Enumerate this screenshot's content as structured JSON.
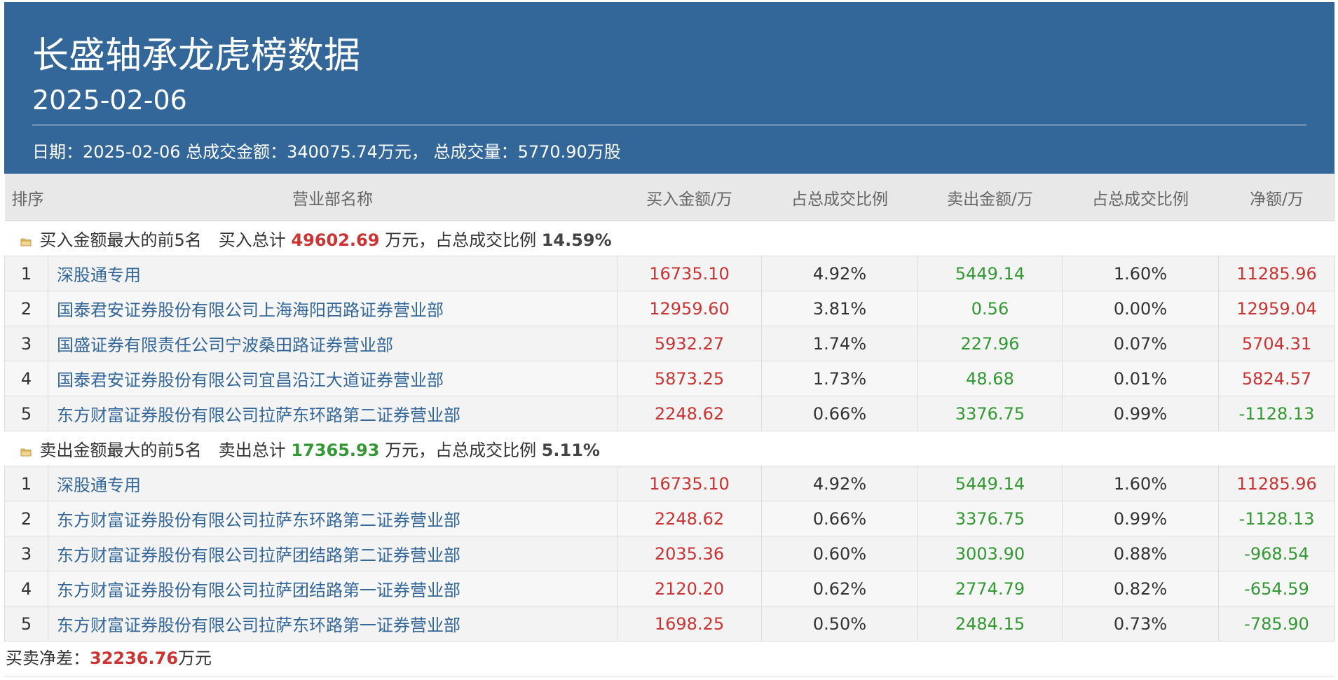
{
  "header": {
    "title": "长盛轴承龙虎榜数据",
    "date": "2025-02-06",
    "summary_date_label": "日期：",
    "summary_date": "2025-02-06",
    "summary_amount_label": " 总成交金额：",
    "summary_amount": "340075.74万元，",
    "summary_volume_label": " 总成交量：",
    "summary_volume": "5770.90万股"
  },
  "columns": {
    "rank": "排序",
    "name": "营业部名称",
    "buy": "买入金额/万",
    "buy_pct": "占总成交比例",
    "sell": "卖出金额/万",
    "sell_pct": "占总成交比例",
    "net": "净额/万"
  },
  "buy_section": {
    "label": "买入金额最大的前5名",
    "total_label": "买入总计",
    "total": "49602.69",
    "unit_text": "万元，占总成交比例",
    "pct": "14.59%",
    "rows": [
      {
        "rank": "1",
        "name": "深股通专用",
        "buy": "16735.10",
        "buy_pct": "4.92%",
        "sell": "5449.14",
        "sell_pct": "1.60%",
        "net": "11285.96"
      },
      {
        "rank": "2",
        "name": "国泰君安证券股份有限公司上海海阳西路证券营业部",
        "buy": "12959.60",
        "buy_pct": "3.81%",
        "sell": "0.56",
        "sell_pct": "0.00%",
        "net": "12959.04"
      },
      {
        "rank": "3",
        "name": "国盛证券有限责任公司宁波桑田路证券营业部",
        "buy": "5932.27",
        "buy_pct": "1.74%",
        "sell": "227.96",
        "sell_pct": "0.07%",
        "net": "5704.31"
      },
      {
        "rank": "4",
        "name": "国泰君安证券股份有限公司宜昌沿江大道证券营业部",
        "buy": "5873.25",
        "buy_pct": "1.73%",
        "sell": "48.68",
        "sell_pct": "0.01%",
        "net": "5824.57"
      },
      {
        "rank": "5",
        "name": "东方财富证券股份有限公司拉萨东环路第二证券营业部",
        "buy": "2248.62",
        "buy_pct": "0.66%",
        "sell": "3376.75",
        "sell_pct": "0.99%",
        "net": "-1128.13"
      }
    ]
  },
  "sell_section": {
    "label": "卖出金额最大的前5名",
    "total_label": "卖出总计",
    "total": "17365.93",
    "unit_text": "万元，占总成交比例",
    "pct": "5.11%",
    "rows": [
      {
        "rank": "1",
        "name": "深股通专用",
        "buy": "16735.10",
        "buy_pct": "4.92%",
        "sell": "5449.14",
        "sell_pct": "1.60%",
        "net": "11285.96"
      },
      {
        "rank": "2",
        "name": "东方财富证券股份有限公司拉萨东环路第二证券营业部",
        "buy": "2248.62",
        "buy_pct": "0.66%",
        "sell": "3376.75",
        "sell_pct": "0.99%",
        "net": "-1128.13"
      },
      {
        "rank": "3",
        "name": "东方财富证券股份有限公司拉萨团结路第二证券营业部",
        "buy": "2035.36",
        "buy_pct": "0.60%",
        "sell": "3003.90",
        "sell_pct": "0.88%",
        "net": "-968.54"
      },
      {
        "rank": "4",
        "name": "东方财富证券股份有限公司拉萨团结路第一证券营业部",
        "buy": "2120.20",
        "buy_pct": "0.62%",
        "sell": "2774.79",
        "sell_pct": "0.82%",
        "net": "-654.59"
      },
      {
        "rank": "5",
        "name": "东方财富证券股份有限公司拉萨东环路第一证券营业部",
        "buy": "1698.25",
        "buy_pct": "0.50%",
        "sell": "2484.15",
        "sell_pct": "0.73%",
        "net": "-785.90"
      }
    ]
  },
  "footer": {
    "label": "买卖净差：",
    "value": "32236.76",
    "unit": "万元"
  },
  "colors": {
    "header_bg": "#336699",
    "positive": "#cc3333",
    "sell": "#339933",
    "name_link": "#336699"
  },
  "icons": {
    "section": "folder-icon"
  }
}
